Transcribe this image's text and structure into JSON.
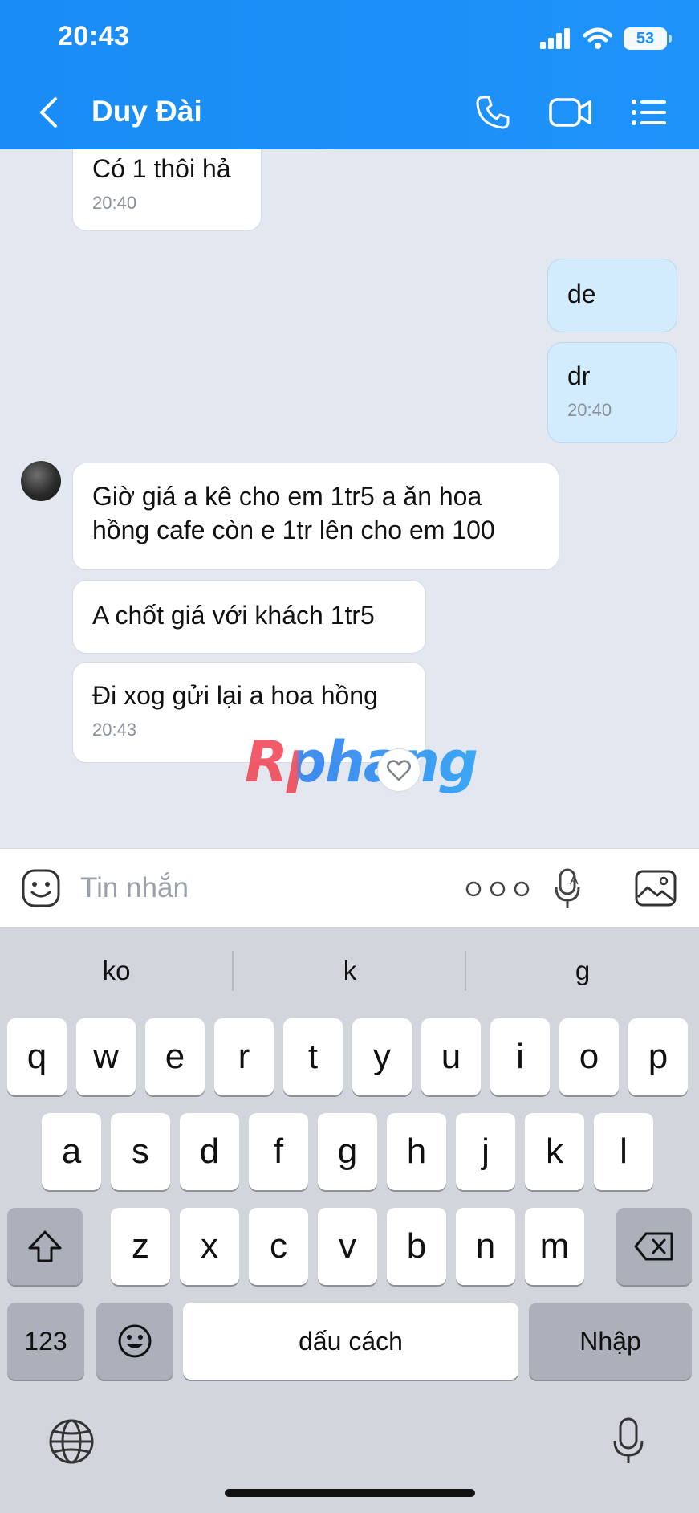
{
  "status_bar": {
    "time": "20:43",
    "battery": "53"
  },
  "header": {
    "contact_name": "Duy Đài"
  },
  "messages": [
    {
      "side": "in",
      "text": "Có 1 thôi hả",
      "time": "20:40"
    },
    {
      "side": "out",
      "text": "de"
    },
    {
      "side": "out",
      "text": "dr",
      "time": "20:40"
    },
    {
      "side": "in",
      "text": "Giờ giá a kê cho em 1tr5 a ăn hoa hồng cafe còn e 1tr lên cho em 100"
    },
    {
      "side": "in",
      "text": "A chốt giá với khách 1tr5"
    },
    {
      "side": "in",
      "text": "Đi xog gửi lại a hoa hồng",
      "time": "20:43"
    }
  ],
  "watermark": "Rphang",
  "input": {
    "placeholder": "Tin nhắn",
    "value": ""
  },
  "keyboard": {
    "suggestions": [
      "ko",
      "k",
      "g"
    ],
    "row1": [
      "q",
      "w",
      "e",
      "r",
      "t",
      "y",
      "u",
      "i",
      "o",
      "p"
    ],
    "row2": [
      "a",
      "s",
      "d",
      "f",
      "g",
      "h",
      "j",
      "k",
      "l"
    ],
    "row3": [
      "z",
      "x",
      "c",
      "v",
      "b",
      "n",
      "m"
    ],
    "numbers_key": "123",
    "space_key": "dấu cách",
    "return_key": "Nhập"
  },
  "icons": {
    "back": "chevron-left-icon",
    "call": "phone-icon",
    "video": "video-camera-icon",
    "menu": "list-icon",
    "sticker": "smiley-sticker-icon",
    "more": "more-dots-icon",
    "voice": "microphone-text-icon",
    "image": "image-icon",
    "reaction": "heart-icon",
    "shift": "shift-arrow-icon",
    "backspace": "backspace-icon",
    "emoji": "emoji-face-icon",
    "globe": "globe-icon",
    "dictation": "microphone-icon"
  },
  "colors": {
    "header_bg": "#1d8ff8",
    "chat_bg": "#e3e8f0",
    "incoming_bubble": "#ffffff",
    "outgoing_bubble": "#d3ecfd",
    "keyboard_bg": "#d2d5db"
  }
}
